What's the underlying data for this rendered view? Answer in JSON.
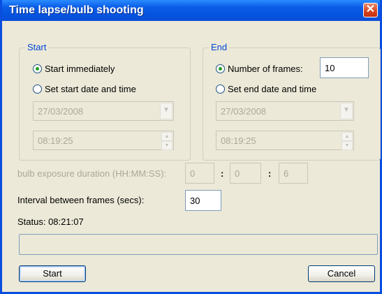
{
  "window": {
    "title": "Time lapse/bulb shooting",
    "close_glyph": "✕"
  },
  "start_group": {
    "label": "Start",
    "options": [
      {
        "label": "Start immediately",
        "selected": true
      },
      {
        "label": "Set start date and time",
        "selected": false
      }
    ],
    "date_value": "27/03/2008",
    "time_value": "08:19:25"
  },
  "end_group": {
    "label": "End",
    "options": [
      {
        "label": "Number of frames:",
        "selected": true
      },
      {
        "label": "Set end date and time",
        "selected": false
      }
    ],
    "frames_value": "10",
    "date_value": "27/03/2008",
    "time_value": "08:19:25"
  },
  "bulb": {
    "label": "bulb exposure duration (HH:MM:SS):",
    "hours": "0",
    "minutes": "0",
    "seconds": "6",
    "separator": ":"
  },
  "interval": {
    "label": "Interval between frames (secs):",
    "value": "30"
  },
  "status": {
    "text": "Status: 08:21:07"
  },
  "progress": {
    "fraction": 0
  },
  "buttons": {
    "start": "Start",
    "cancel": "Cancel"
  },
  "colors": {
    "titlebar": "#0a5ce6",
    "group_label": "#0046d5",
    "dialog_bg": "#ece9d8"
  },
  "icons": {
    "dropdown": "chevron-down-icon",
    "spin": "spinner-arrows-icon",
    "close": "close-icon"
  }
}
